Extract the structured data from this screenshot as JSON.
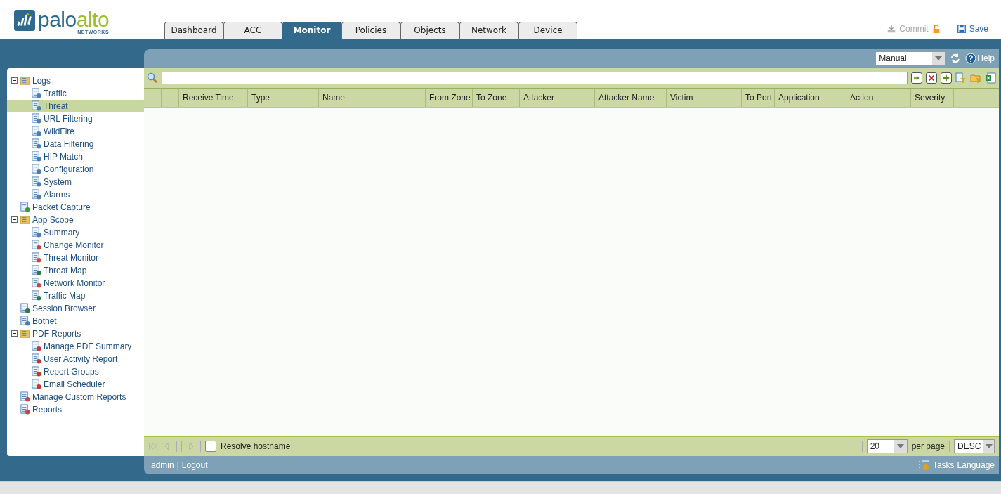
{
  "logo": {
    "words": [
      "palo",
      "alto"
    ],
    "sub": "NETWORKS"
  },
  "tabs": [
    {
      "label": "Dashboard",
      "selected": false
    },
    {
      "label": "ACC",
      "selected": false
    },
    {
      "label": "Monitor",
      "selected": true
    },
    {
      "label": "Policies",
      "selected": false
    },
    {
      "label": "Objects",
      "selected": false
    },
    {
      "label": "Network",
      "selected": false
    },
    {
      "label": "Device",
      "selected": false
    }
  ],
  "actions": [
    {
      "label": "Commit",
      "kind": "commit",
      "disabled": true
    },
    {
      "label": "Save",
      "kind": "save",
      "disabled": false
    }
  ],
  "sidebar": {
    "items": [
      {
        "label": "Logs",
        "kind": "folder",
        "expanded": true,
        "selected": false,
        "children": [
          {
            "label": "Traffic",
            "kind": "log",
            "selected": false
          },
          {
            "label": "Threat",
            "kind": "log",
            "selected": true
          },
          {
            "label": "URL Filtering",
            "kind": "log",
            "selected": false
          },
          {
            "label": "WildFire",
            "kind": "log",
            "selected": false
          },
          {
            "label": "Data Filtering",
            "kind": "log",
            "selected": false
          },
          {
            "label": "HIP Match",
            "kind": "log",
            "selected": false
          },
          {
            "label": "Configuration",
            "kind": "log",
            "selected": false
          },
          {
            "label": "System",
            "kind": "log",
            "selected": false
          },
          {
            "label": "Alarms",
            "kind": "log",
            "selected": false
          }
        ]
      },
      {
        "label": "Packet Capture",
        "kind": "capture",
        "selected": false
      },
      {
        "label": "App Scope",
        "kind": "folder",
        "expanded": true,
        "selected": false,
        "children": [
          {
            "label": "Summary",
            "kind": "grid",
            "selected": false
          },
          {
            "label": "Change Monitor",
            "kind": "chart",
            "selected": false
          },
          {
            "label": "Threat Monitor",
            "kind": "chart",
            "selected": false
          },
          {
            "label": "Threat Map",
            "kind": "globe",
            "selected": false
          },
          {
            "label": "Network Monitor",
            "kind": "chart",
            "selected": false
          },
          {
            "label": "Traffic Map",
            "kind": "globe",
            "selected": false
          }
        ]
      },
      {
        "label": "Session Browser",
        "kind": "globe",
        "selected": false
      },
      {
        "label": "Botnet",
        "kind": "monitor",
        "selected": false
      },
      {
        "label": "PDF Reports",
        "kind": "folder",
        "expanded": true,
        "selected": false,
        "children": [
          {
            "label": "Manage PDF Summary",
            "kind": "report",
            "selected": false
          },
          {
            "label": "User Activity Report",
            "kind": "report",
            "selected": false
          },
          {
            "label": "Report Groups",
            "kind": "report",
            "selected": false
          },
          {
            "label": "Email Scheduler",
            "kind": "report",
            "selected": false
          }
        ]
      },
      {
        "label": "Manage Custom Reports",
        "kind": "chart",
        "selected": false
      },
      {
        "label": "Reports",
        "kind": "chart",
        "selected": false
      }
    ]
  },
  "panel": {
    "refresh_mode": "Manual",
    "help": "Help",
    "table": {
      "columns": [
        "Receive Time",
        "Type",
        "Name",
        "From Zone",
        "To Zone",
        "Attacker",
        "Attacker Name",
        "Victim",
        "To Port",
        "Application",
        "Action",
        "Severity"
      ]
    },
    "footer": {
      "resolve_hostname": {
        "label": "Resolve hostname",
        "checked": false
      },
      "page_size": "20",
      "per_page": "per page",
      "sort": "DESC"
    },
    "status": {
      "user": "admin",
      "separator": "|",
      "logout": "Logout",
      "tasks": "Tasks",
      "language": "Language"
    }
  }
}
